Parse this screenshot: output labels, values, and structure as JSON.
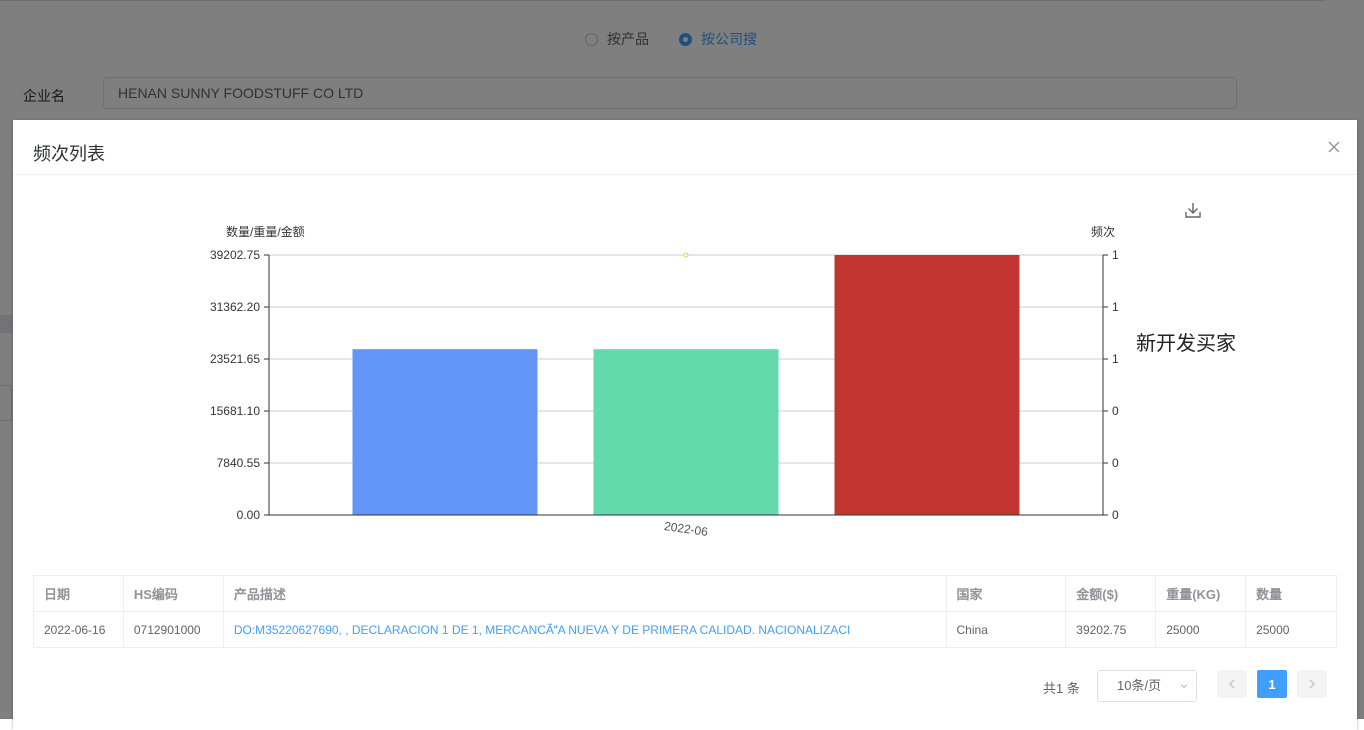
{
  "search_mode": {
    "options": [
      {
        "label": "按产品",
        "checked": false
      },
      {
        "label": "按公司搜",
        "checked": true
      }
    ]
  },
  "company": {
    "label": "企业名",
    "value": "HENAN SUNNY FOODSTUFF CO LTD"
  },
  "dialog": {
    "title": "频次列表",
    "close_icon": "close-icon",
    "download_icon": "download-icon"
  },
  "chart_data": {
    "type": "bar",
    "ylabel": "数量/重量/金额",
    "y2label": "频次",
    "categories": [
      "2022-06"
    ],
    "series": [
      {
        "values": [
          25000
        ],
        "color": "#6395f9"
      },
      {
        "values": [
          25000
        ],
        "color": "#62daab"
      },
      {
        "values": [
          39202.75
        ],
        "color": "#c23531"
      },
      {
        "name": "新开发买家",
        "type": "line",
        "axis": "right",
        "values": [
          1
        ],
        "color": "#f6c85f"
      }
    ],
    "ylim": [
      0,
      39202.75
    ],
    "yticks": [
      "39202.75",
      "31362.20",
      "23521.65",
      "15681.10",
      "7840.55",
      "0.00"
    ],
    "y2ticks": [
      "1",
      "1",
      "1",
      "0",
      "0",
      "0"
    ],
    "grid": true,
    "legend": "right"
  },
  "table": {
    "columns": [
      "日期",
      "HS编码",
      "产品描述",
      "国家",
      "金额($)",
      "重量(KG)",
      "数量"
    ],
    "rows": [
      [
        "2022-06-16",
        "0712901000",
        "DO:M35220627690, , DECLARACION 1 DE 1, MERCANCÃA NUEVA Y DE PRIMERA CALIDAD. NACIONALIZACI",
        "China",
        "39202.75",
        "25000",
        "25000"
      ]
    ]
  },
  "pagination": {
    "total": "共1 条",
    "page_size": "10条/页",
    "current_page": "1"
  }
}
